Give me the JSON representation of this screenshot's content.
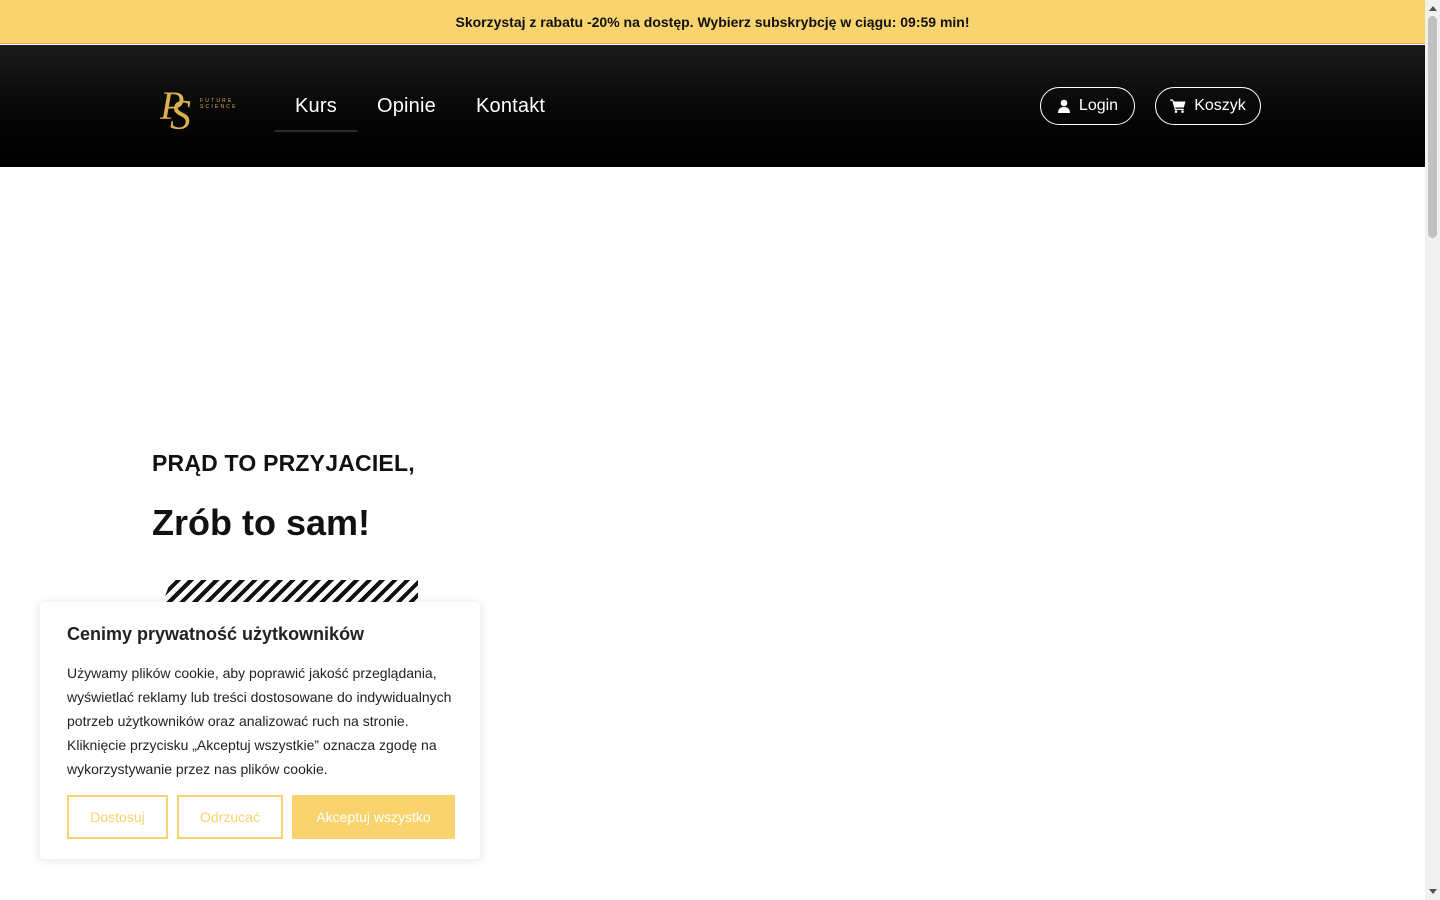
{
  "promo": {
    "text": "Skorzystaj z rabatu -20% na dostęp. Wybierz subskrybcję w ciągu: 09:59 min!"
  },
  "header": {
    "logo_text": "FUTURE SCIENCE",
    "nav": [
      {
        "label": "Kurs",
        "active": true
      },
      {
        "label": "Opinie",
        "active": false
      },
      {
        "label": "Kontakt",
        "active": false
      }
    ],
    "login_label": "Login",
    "cart_label": "Koszyk"
  },
  "hero": {
    "kicker": "PRĄD TO PRZYJACIEL,",
    "title": "Zrób to sam!"
  },
  "cookie": {
    "title": "Cenimy prywatność użytkowników",
    "text": "Używamy plików cookie, aby poprawić jakość przeglądania, wyświetlać reklamy lub treści dostosowane do indywidualnych potrzeb użytkowników oraz analizować ruch na stronie. Kliknięcie przycisku „Akceptuj wszystkie” oznacza zgodę na wykorzystywanie przez nas plików cookie.",
    "customize_label": "Dostosuj",
    "reject_label": "Odrzucać",
    "accept_label": "Akceptuj wszystko"
  },
  "colors": {
    "accent": "#f8d36e",
    "header_bg": "#000000",
    "logo_gold": "#d9b24f"
  },
  "icons": {
    "login": "user-icon",
    "cart": "cart-icon"
  }
}
